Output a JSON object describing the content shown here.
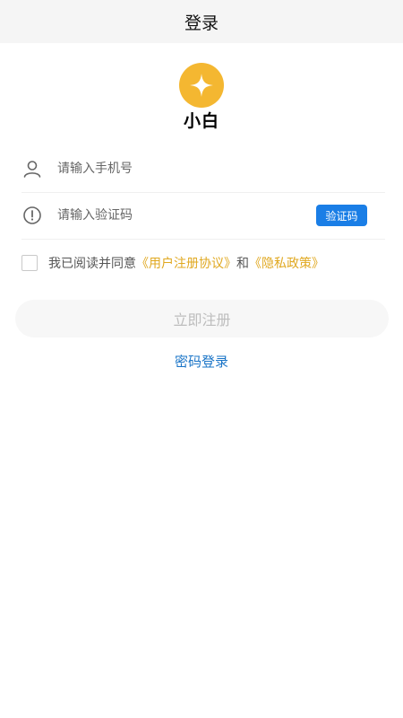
{
  "header": {
    "title": "登录"
  },
  "logo": {
    "text": "小白",
    "color": "#f4b731"
  },
  "phone": {
    "placeholder": "请输入手机号",
    "icon": "user-icon"
  },
  "code": {
    "placeholder": "请输入验证码",
    "icon": "alert-circle-icon",
    "button_label": "验证码",
    "button_color": "#1a7ee6"
  },
  "agreement": {
    "prefix": "我已阅读并同意",
    "user_agreement": "《用户注册协议》",
    "and": "和",
    "privacy_policy": "《隐私政策》",
    "link_color": "#e0a820",
    "checked": false
  },
  "register_button": {
    "label": "立即注册"
  },
  "password_login": {
    "label": "密码登录",
    "color": "#1a74c7"
  }
}
